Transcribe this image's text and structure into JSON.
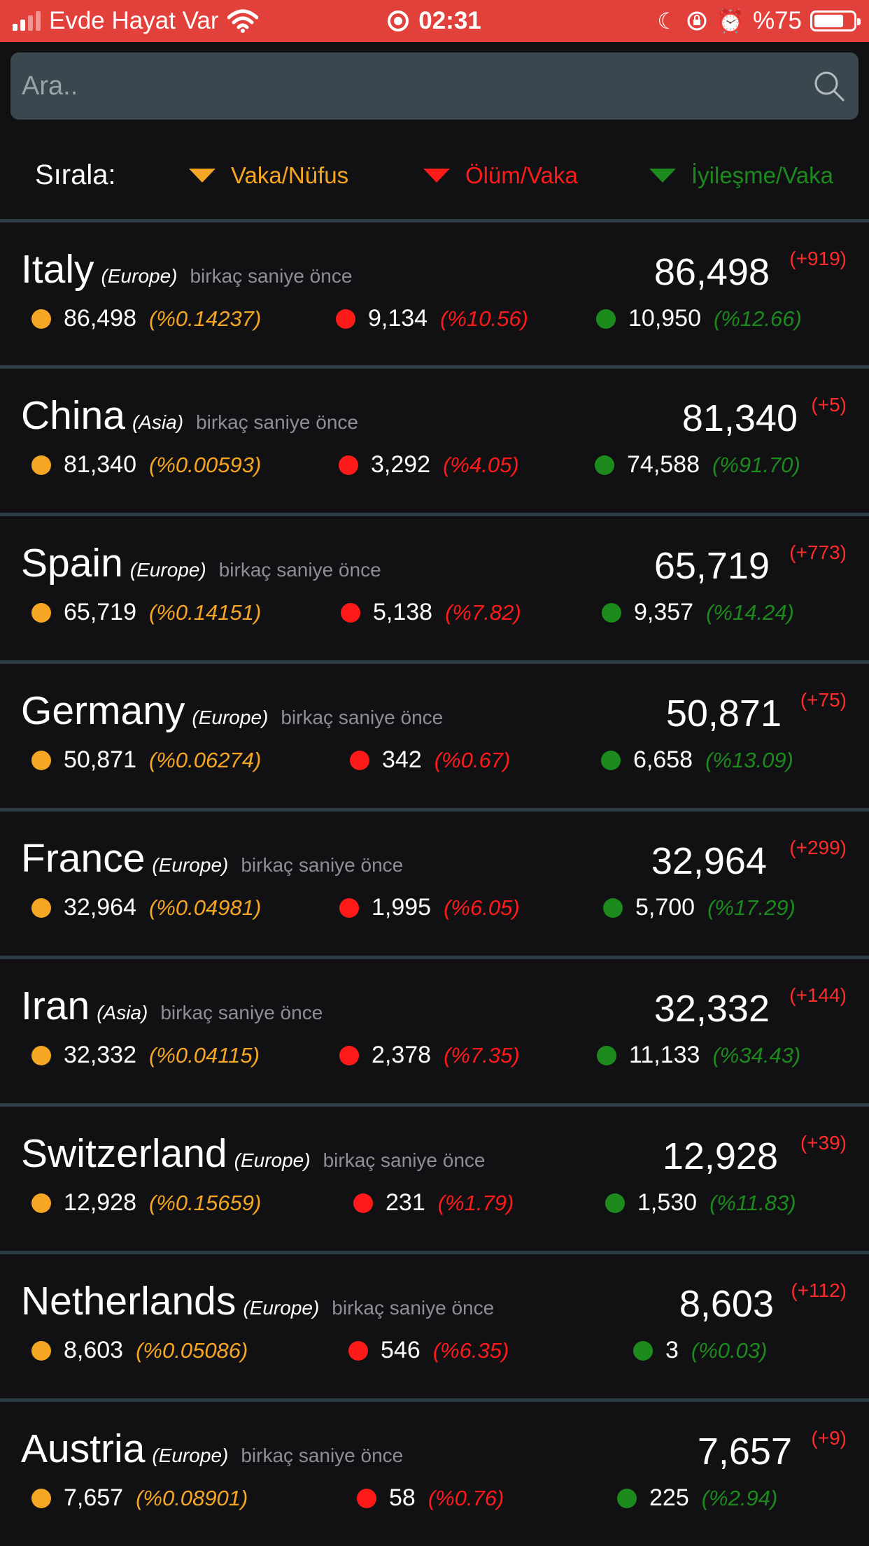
{
  "status_bar": {
    "carrier": "Evde Hayat Var",
    "time": "02:31",
    "battery": "%75",
    "battery_level": 0.75
  },
  "search": {
    "placeholder": "Ara.."
  },
  "sort": {
    "label": "Sırala:",
    "options": [
      {
        "label": "Vaka/Nüfus",
        "color": "#f5a623"
      },
      {
        "label": "Ölüm/Vaka",
        "color": "#ff1a1a"
      },
      {
        "label": "İyileşme/Vaka",
        "color": "#1d8a1d"
      }
    ]
  },
  "colors": {
    "cases": "#f5a623",
    "deaths": "#ff1a1a",
    "recovered": "#1d8a1d",
    "delta": "#ff2a2a"
  },
  "countries": [
    {
      "name": "Italy",
      "continent": "(Europe)",
      "updated": "birkaç saniye önce",
      "total": "86,498",
      "delta": "(+919)",
      "cases": "86,498",
      "cases_pct": "(%0.14237)",
      "deaths": "9,134",
      "deaths_pct": "(%10.56)",
      "recovered": "10,950",
      "recovered_pct": "(%12.66)"
    },
    {
      "name": "China",
      "continent": "(Asia)",
      "updated": "birkaç saniye önce",
      "total": "81,340",
      "delta": "(+5)",
      "cases": "81,340",
      "cases_pct": "(%0.00593)",
      "deaths": "3,292",
      "deaths_pct": "(%4.05)",
      "recovered": "74,588",
      "recovered_pct": "(%91.70)"
    },
    {
      "name": "Spain",
      "continent": "(Europe)",
      "updated": "birkaç saniye önce",
      "total": "65,719",
      "delta": "(+773)",
      "cases": "65,719",
      "cases_pct": "(%0.14151)",
      "deaths": "5,138",
      "deaths_pct": "(%7.82)",
      "recovered": "9,357",
      "recovered_pct": "(%14.24)"
    },
    {
      "name": "Germany",
      "continent": "(Europe)",
      "updated": "birkaç saniye önce",
      "total": "50,871",
      "delta": "(+75)",
      "cases": "50,871",
      "cases_pct": "(%0.06274)",
      "deaths": "342",
      "deaths_pct": "(%0.67)",
      "recovered": "6,658",
      "recovered_pct": "(%13.09)"
    },
    {
      "name": "France",
      "continent": "(Europe)",
      "updated": "birkaç saniye önce",
      "total": "32,964",
      "delta": "(+299)",
      "cases": "32,964",
      "cases_pct": "(%0.04981)",
      "deaths": "1,995",
      "deaths_pct": "(%6.05)",
      "recovered": "5,700",
      "recovered_pct": "(%17.29)"
    },
    {
      "name": "Iran",
      "continent": "(Asia)",
      "updated": "birkaç saniye önce",
      "total": "32,332",
      "delta": "(+144)",
      "cases": "32,332",
      "cases_pct": "(%0.04115)",
      "deaths": "2,378",
      "deaths_pct": "(%7.35)",
      "recovered": "11,133",
      "recovered_pct": "(%34.43)"
    },
    {
      "name": "Switzerland",
      "continent": "(Europe)",
      "updated": "birkaç saniye önce",
      "total": "12,928",
      "delta": "(+39)",
      "cases": "12,928",
      "cases_pct": "(%0.15659)",
      "deaths": "231",
      "deaths_pct": "(%1.79)",
      "recovered": "1,530",
      "recovered_pct": "(%11.83)"
    },
    {
      "name": "Netherlands",
      "continent": "(Europe)",
      "updated": "birkaç saniye önce",
      "total": "8,603",
      "delta": "(+112)",
      "cases": "8,603",
      "cases_pct": "(%0.05086)",
      "deaths": "546",
      "deaths_pct": "(%6.35)",
      "recovered": "3",
      "recovered_pct": "(%0.03)"
    },
    {
      "name": "Austria",
      "continent": "(Europe)",
      "updated": "birkaç saniye önce",
      "total": "7,657",
      "delta": "(+9)",
      "cases": "7,657",
      "cases_pct": "(%0.08901)",
      "deaths": "58",
      "deaths_pct": "(%0.76)",
      "recovered": "225",
      "recovered_pct": "(%2.94)"
    }
  ]
}
